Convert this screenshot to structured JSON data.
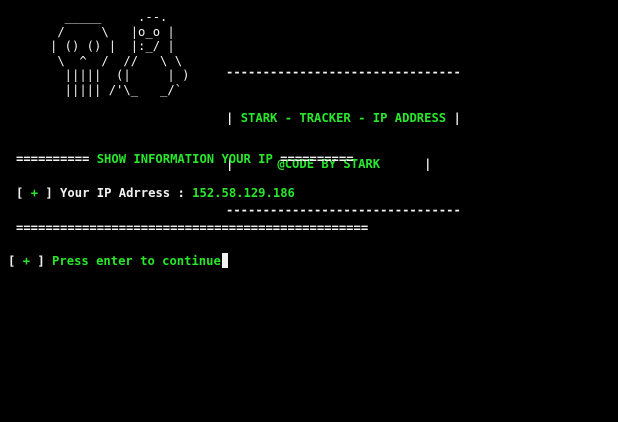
{
  "ascii_art": {
    "lines": [
      "  _____     .--.",
      " /     \\   |o_o |",
      "| () () |  |:_/ |",
      " \\  ^  /  //   \\ \\",
      "  |||||  (|     | )",
      "  ||||| /'\\_   _/`"
    ]
  },
  "banner": {
    "rule_top": "--------------------------------",
    "title_bar_left": "| ",
    "title": "STARK - TRACKER - IP ADDRESS",
    "title_bar_right": " |",
    "credit_bar_left": "|      ",
    "credit": "@CODE BY STARK",
    "credit_bar_right": "      |",
    "rule_bottom": "--------------------------------"
  },
  "info_header": {
    "left_rule": "==========",
    "label": "SHOW INFORMATION YOUR IP",
    "right_rule": "=========="
  },
  "ip_row": {
    "bracket_open": "[ ",
    "marker": "+",
    "bracket_close": " ]",
    "label": " Your IP Adrress : ",
    "value": "152.58.129.186"
  },
  "divider": "================================================",
  "prompt": {
    "bracket_open": "[ ",
    "marker": "+",
    "bracket_close": " ]",
    "text": " Press enter to continue"
  },
  "colors": {
    "background": "#000000",
    "text": "#f2f2f2",
    "accent": "#29e62c"
  }
}
